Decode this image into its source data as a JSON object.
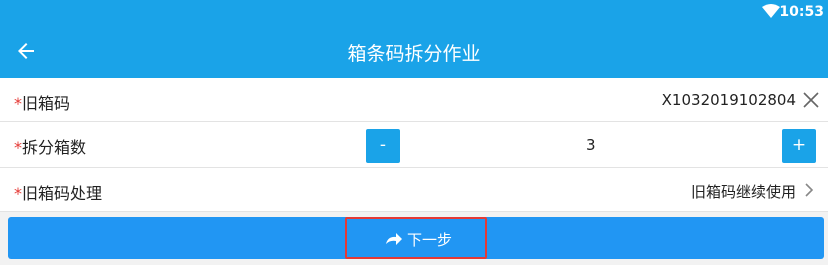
{
  "status_bar": {
    "time": "10:53"
  },
  "header": {
    "title": "箱条码拆分作业"
  },
  "form": {
    "old_box_code": {
      "required_mark": "*",
      "label": "旧箱码",
      "value": "X1032019102804"
    },
    "split_count": {
      "required_mark": "*",
      "label": "拆分箱数",
      "value": "3",
      "minus_label": "-",
      "plus_label": "+"
    },
    "old_box_handling": {
      "required_mark": "*",
      "label": "旧箱码处理",
      "value": "旧箱码继续使用"
    }
  },
  "footer": {
    "next_label": "下一步"
  },
  "colors": {
    "primary": "#1aa3e8",
    "button": "#2196f3",
    "required": "#e53935",
    "highlight_border": "#e53935"
  },
  "icons": [
    "wifi-icon",
    "back-arrow-icon",
    "clear-icon",
    "chevron-right-icon",
    "redo-arrow-icon"
  ]
}
